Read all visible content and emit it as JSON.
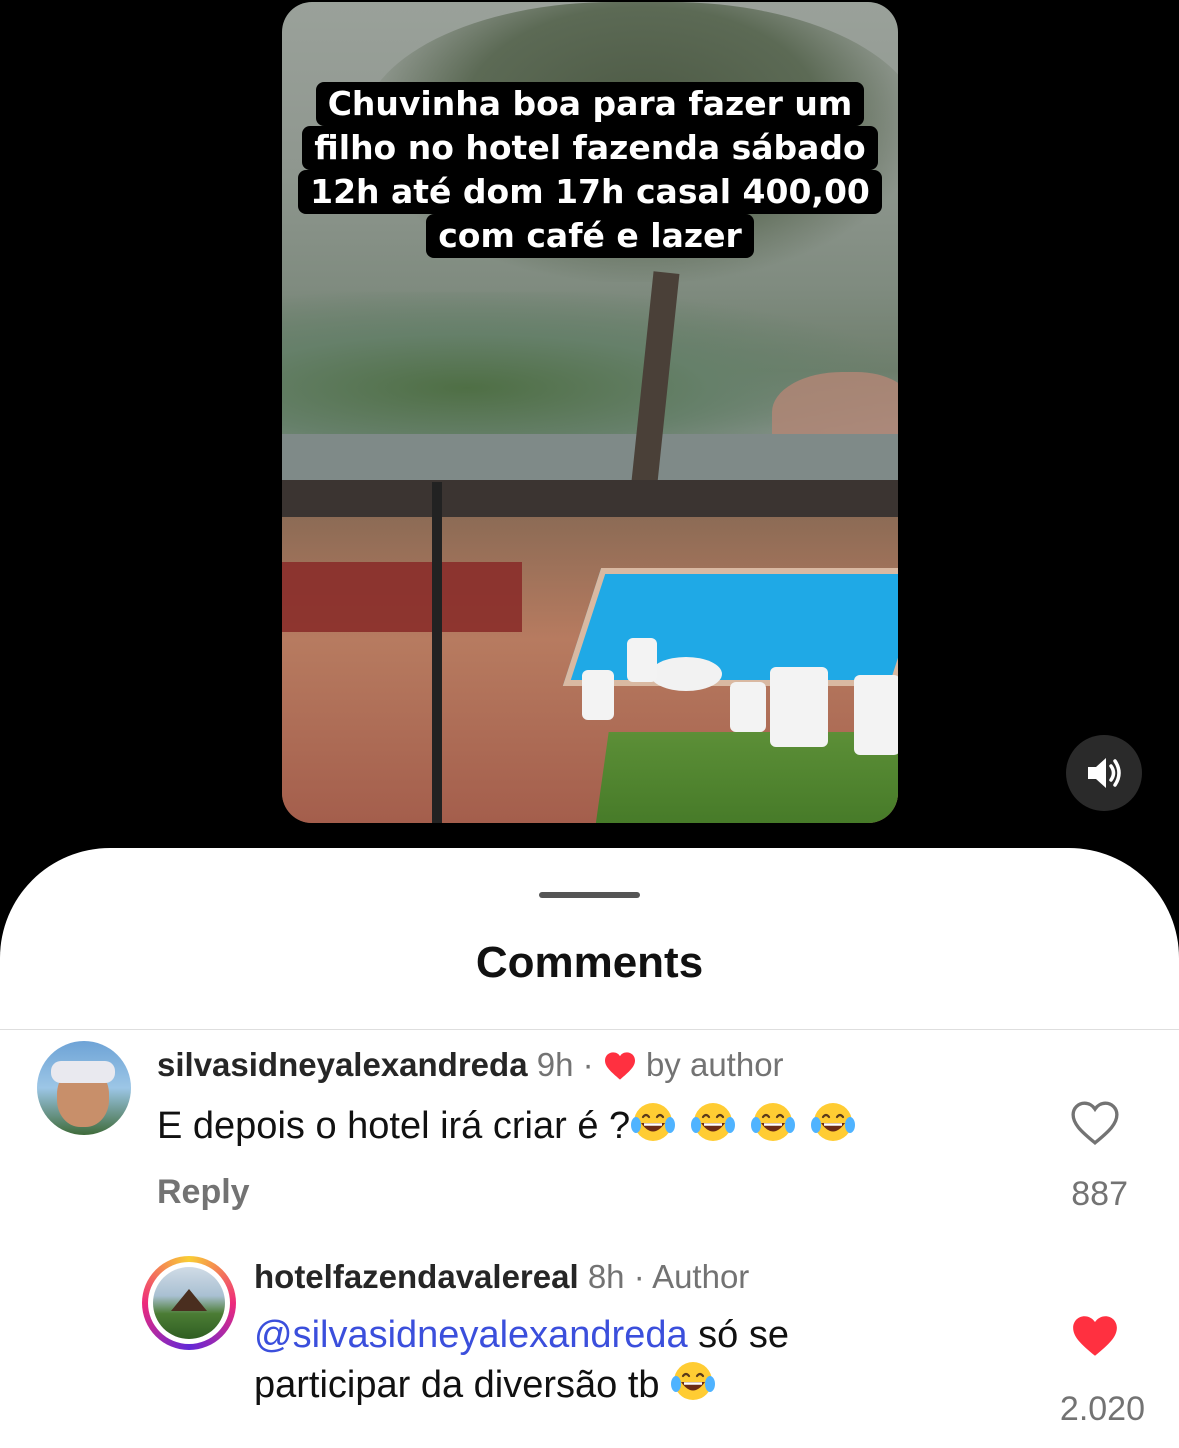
{
  "video": {
    "caption_lines": [
      "Chuvinha boa para fazer um",
      "filho no hotel fazenda sábado",
      "12h até dom 17h casal 400,00",
      "com café e lazer"
    ],
    "sound_icon": "speaker-on-icon"
  },
  "comments_sheet": {
    "title": "Comments",
    "comments": [
      {
        "username": "silvasidneyalexandreda",
        "time": "9h",
        "separator": "·",
        "badge": "by author",
        "text": "E depois o hotel irá criar é ?",
        "emoji_count": 4,
        "reply_label": "Reply",
        "likes": "887",
        "liked": false
      },
      {
        "username": "hotelfazendavalereal",
        "time": "8h",
        "separator": "·",
        "badge": "Author",
        "mention": "@silvasidneyalexandreda",
        "text_after_mention": " só se",
        "text_line2": "participar da diversão tb",
        "emoji_count": 1,
        "likes": "2.020",
        "liked": true
      }
    ]
  },
  "colors": {
    "heart_red": "#ff3040",
    "mention_blue": "#3b4fdc",
    "meta_gray": "#737373"
  }
}
